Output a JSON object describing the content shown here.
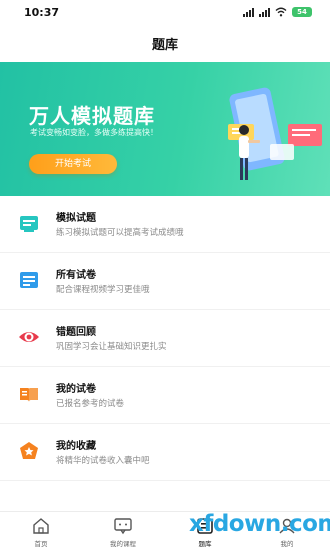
{
  "status": {
    "time": "10:37",
    "battery": "54"
  },
  "header": {
    "title": "题库"
  },
  "banner": {
    "title": "万人模拟题库",
    "subtitle": "考试变畅如变脸，多做多练提高快！",
    "button_label": "开始考试"
  },
  "list": [
    {
      "title": "模拟试题",
      "subtitle": "练习模拟试题可以提高考试成绩哦",
      "icon": "exam-card-icon",
      "color": "#26c6c0"
    },
    {
      "title": "所有试卷",
      "subtitle": "配合课程视频学习更佳哦",
      "icon": "papers-icon",
      "color": "#2f9bea"
    },
    {
      "title": "错题回顾",
      "subtitle": "巩固学习会让基础知识更扎实",
      "icon": "eye-icon",
      "color": "#e83a4c"
    },
    {
      "title": "我的试卷",
      "subtitle": "已报名参考的试卷",
      "icon": "book-icon",
      "color": "#f5821f"
    },
    {
      "title": "我的收藏",
      "subtitle": "将精华的试卷收入囊中吧",
      "icon": "star-icon",
      "color": "#f5821f"
    }
  ],
  "tabbar": [
    {
      "label": "首页",
      "icon": "home-icon"
    },
    {
      "label": "我的课程",
      "icon": "course-icon"
    },
    {
      "label": "题库",
      "icon": "question-bank-icon"
    },
    {
      "label": "我的",
      "icon": "user-icon"
    }
  ],
  "watermark": "xfdown.com"
}
